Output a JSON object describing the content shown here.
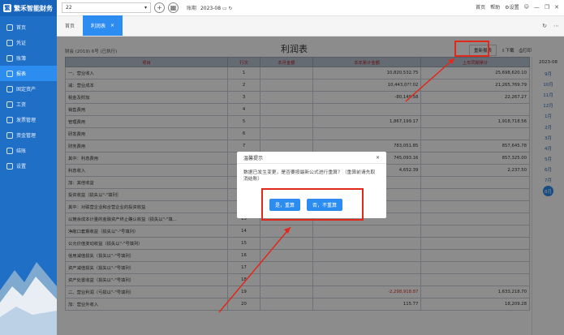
{
  "app": {
    "name": "繁禾智能财务"
  },
  "sidebar": {
    "items": [
      {
        "label": "首页"
      },
      {
        "label": "凭证"
      },
      {
        "label": "账簿"
      },
      {
        "label": "报表"
      },
      {
        "label": "固定资产"
      },
      {
        "label": "工资"
      },
      {
        "label": "发票管理"
      },
      {
        "label": "资金管理"
      },
      {
        "label": "结账"
      },
      {
        "label": "设置"
      }
    ]
  },
  "topbar": {
    "account_value": "22",
    "period_label": "账期",
    "period_value": "2023-08",
    "links": [
      "首页",
      "帮助",
      "设置"
    ]
  },
  "tabs": [
    {
      "label": "首页"
    },
    {
      "label": "利润表"
    }
  ],
  "report": {
    "subtitle": "财会 (2019) 6号 (已执行)",
    "title": "利润表",
    "recalc_label": "重新报表",
    "download_label": "下载",
    "print_label": "打印",
    "headers": [
      "项目",
      "行次",
      "本月金额",
      "本年累计金额",
      "上年同期累计"
    ],
    "rows": [
      {
        "name": "一、营业收入",
        "idx": "1",
        "month": "",
        "year": "10,820,532.75",
        "last": "25,698,620.10",
        "neg": false
      },
      {
        "name": "减：营业成本",
        "idx": "2",
        "month": "",
        "year": "10,443,0??.02",
        "last": "21,265,769.79",
        "neg": false
      },
      {
        "name": "税金及附加",
        "idx": "3",
        "month": "",
        "year": "-80,149.58",
        "last": "22,267.27",
        "neg": false
      },
      {
        "name": "销售费用",
        "idx": "4",
        "month": "",
        "year": "",
        "last": "",
        "neg": false
      },
      {
        "name": "管理费用",
        "idx": "5",
        "month": "",
        "year": "1,867,199.17",
        "last": "1,918,718.56",
        "neg": false
      },
      {
        "name": "研发费用",
        "idx": "6",
        "month": "",
        "year": "",
        "last": "",
        "neg": false
      },
      {
        "name": "财务费用",
        "idx": "7",
        "month": "",
        "year": "783,051.85",
        "last": "857,645.78",
        "neg": false
      },
      {
        "name": "其中：利息费用",
        "idx": "8",
        "month": "",
        "year": "745,093.16",
        "last": "857,325.00",
        "neg": false
      },
      {
        "name": "利息收入",
        "idx": "9",
        "month": "",
        "year": "4,652.39",
        "last": "2,237.50",
        "neg": false
      },
      {
        "name": "加：其他收益",
        "idx": "10",
        "month": "",
        "year": "",
        "last": "",
        "neg": false
      },
      {
        "name": "投资收益（损失以\"-\"填列）",
        "idx": "11",
        "month": "",
        "year": "",
        "last": "",
        "neg": false
      },
      {
        "name": "其中：对联营企业和合营企业的投资收益",
        "idx": "12",
        "month": "",
        "year": "",
        "last": "",
        "neg": false
      },
      {
        "name": "以摊余成本计量的金融资产终止确认收益（损失以\"-\"填…",
        "idx": "13",
        "month": "",
        "year": "",
        "last": "",
        "neg": false
      },
      {
        "name": "净敞口套期收益（损失以\"-\"号填列）",
        "idx": "14",
        "month": "",
        "year": "",
        "last": "",
        "neg": false
      },
      {
        "name": "公允价值变动收益（损失以\"-\"号填列）",
        "idx": "15",
        "month": "",
        "year": "",
        "last": "",
        "neg": false
      },
      {
        "name": "信用减值损失（损失以\"-\"号填列）",
        "idx": "16",
        "month": "",
        "year": "",
        "last": "",
        "neg": false
      },
      {
        "name": "资产减值损失（损失以\"-\"号填列）",
        "idx": "17",
        "month": "",
        "year": "",
        "last": "",
        "neg": false
      },
      {
        "name": "资产处置收益（损失以\"-\"号填列）",
        "idx": "18",
        "month": "",
        "year": "",
        "last": "",
        "neg": false
      },
      {
        "name": "二、营业利润（亏损以\"-\"号填列）",
        "idx": "19",
        "month": "",
        "year": "-2,298,918.87",
        "last": "1,633,218.70",
        "neg": true
      },
      {
        "name": "加：营业外收入",
        "idx": "20",
        "month": "",
        "year": "115.77",
        "last": "18,209.28",
        "neg": false
      }
    ]
  },
  "periods": {
    "year": "2023-08",
    "months": [
      "9月",
      "10月",
      "11月",
      "12月",
      "1月",
      "2月",
      "3月",
      "4月",
      "5月",
      "6月",
      "7月",
      "8月"
    ],
    "current": "8月"
  },
  "dialog": {
    "title": "温馨提示",
    "message": "数据已发生变更，是否要按最新公式进行重算？（重算前请先取消结账）",
    "ok_label": "是，重算",
    "cancel_label": "否，不重算"
  }
}
